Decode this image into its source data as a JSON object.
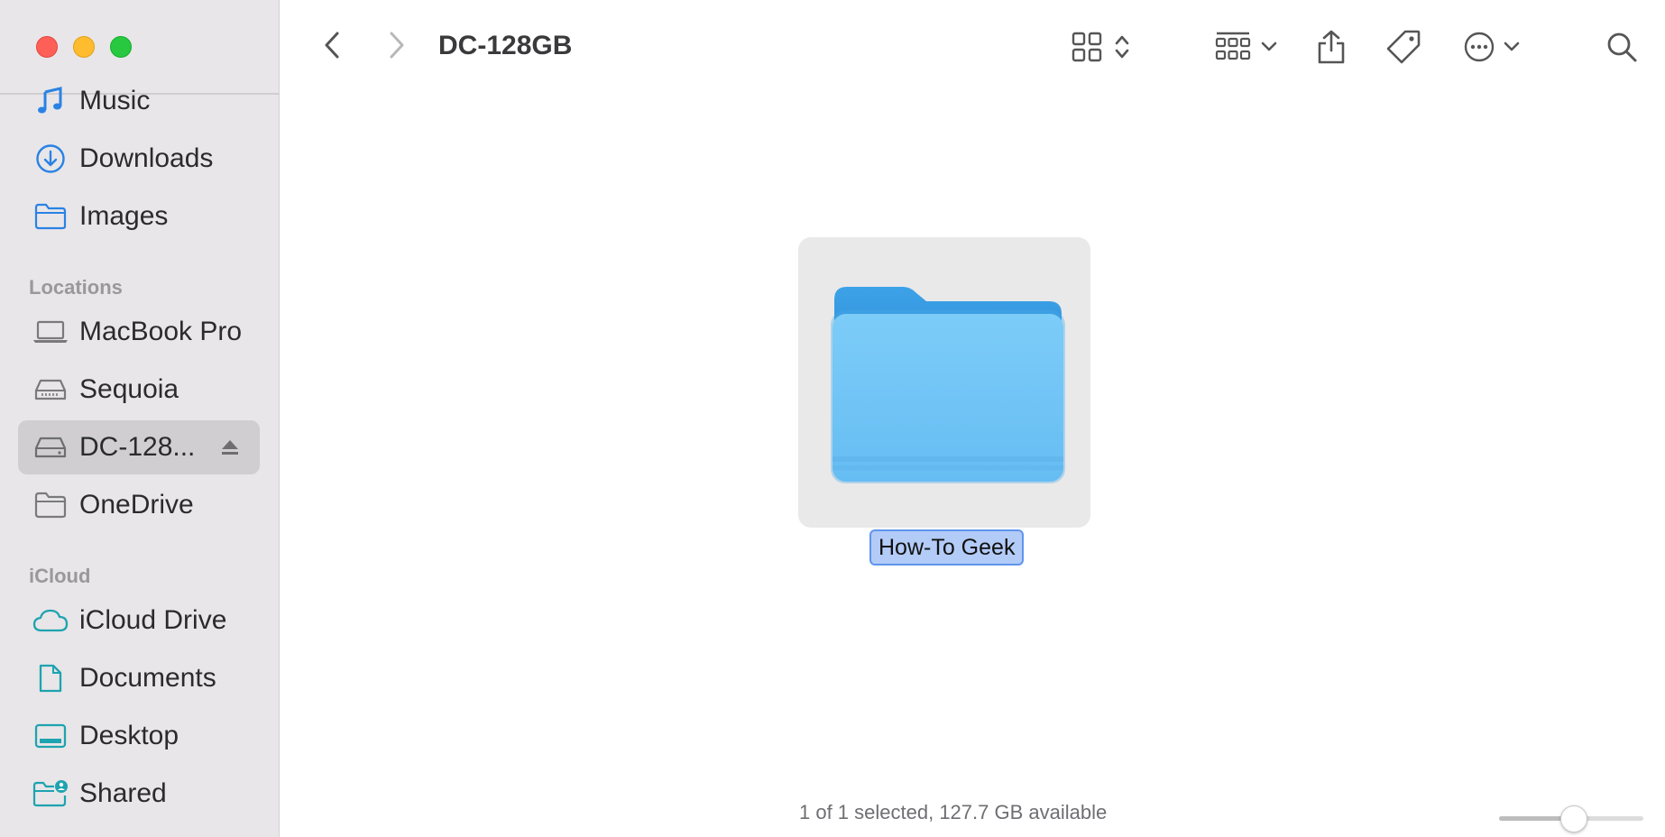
{
  "window": {
    "title": "DC-128GB"
  },
  "sidebar": {
    "favorites": [
      {
        "label": "Music",
        "icon": "music-note-icon"
      },
      {
        "label": "Downloads",
        "icon": "download-circle-icon"
      },
      {
        "label": "Images",
        "icon": "folder-icon"
      }
    ],
    "locations_header": "Locations",
    "locations": [
      {
        "label": "MacBook Pro",
        "icon": "laptop-icon"
      },
      {
        "label": "Sequoia",
        "icon": "hard-drive-icon"
      },
      {
        "label": "DC-128...",
        "icon": "external-drive-icon",
        "selected": true,
        "eject": true
      },
      {
        "label": "OneDrive",
        "icon": "folder-icon"
      }
    ],
    "icloud_header": "iCloud",
    "icloud": [
      {
        "label": "iCloud Drive",
        "icon": "cloud-icon"
      },
      {
        "label": "Documents",
        "icon": "document-icon"
      },
      {
        "label": "Desktop",
        "icon": "desktop-icon"
      },
      {
        "label": "Shared",
        "icon": "shared-folder-icon"
      }
    ]
  },
  "content": {
    "items": [
      {
        "name": "How-To Geek",
        "type": "folder",
        "selected": true,
        "renaming": true
      }
    ]
  },
  "status": {
    "text": "1 of 1 selected, 127.7 GB available"
  },
  "zoom_slider": {
    "value_fraction": 0.52
  },
  "colors": {
    "accent": "#1f7bf2",
    "sidebar_icon": "#2a82e4",
    "icloud_icon": "#1ea3b0",
    "folder_front": "#6ec5f7",
    "folder_back": "#3a9fe6",
    "selection_fill": "#b3cbf7"
  }
}
